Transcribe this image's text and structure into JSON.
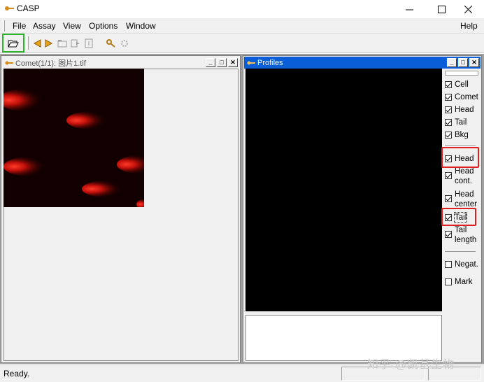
{
  "window": {
    "title": "CASP"
  },
  "menu": [
    "File",
    "Assay",
    "View",
    "Options",
    "Window"
  ],
  "menu_help": "Help",
  "comet_window": {
    "title": "Comet(1/1): 图片1.tif"
  },
  "profiles_window": {
    "title": "Profiles",
    "checkboxes": [
      {
        "label": "Cell",
        "checked": true
      },
      {
        "label": "Comet",
        "checked": true
      },
      {
        "label": "Head",
        "checked": true
      },
      {
        "label": "Tail",
        "checked": true
      },
      {
        "label": "Bkg",
        "checked": true
      },
      {
        "label": "Head",
        "checked": true
      },
      {
        "label": "Head cont.",
        "checked": true
      },
      {
        "label": "Head center",
        "checked": true
      },
      {
        "label": "Tail",
        "checked": true
      },
      {
        "label": "Tail length",
        "checked": true
      },
      {
        "label": "Negat.",
        "checked": false
      },
      {
        "label": "Mark",
        "checked": false
      }
    ]
  },
  "status": {
    "text": "Ready."
  },
  "watermark": "知乎 @凯基生物",
  "colors": {
    "active_title": "#0a5fd8",
    "highlight_green": "#2db52d",
    "highlight_red": "#e02020"
  }
}
